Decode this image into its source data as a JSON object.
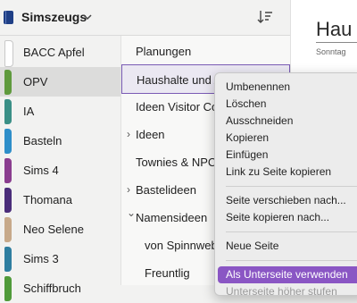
{
  "notebook": {
    "title": "Simszeugs"
  },
  "sections": [
    {
      "label": "BACC Apfel",
      "color": "#ffffff",
      "selected": false
    },
    {
      "label": "OPV",
      "color": "#5f9a3d",
      "selected": true
    },
    {
      "label": "IA",
      "color": "#3a8f86",
      "selected": false
    },
    {
      "label": "Basteln",
      "color": "#2e8ec9",
      "selected": false
    },
    {
      "label": "Sims 4",
      "color": "#8a3d8f",
      "selected": false
    },
    {
      "label": "Thomana",
      "color": "#4a2d7a",
      "selected": false
    },
    {
      "label": "Neo Selene",
      "color": "#c7a98a",
      "selected": false
    },
    {
      "label": "Sims 3",
      "color": "#2f7ea0",
      "selected": false
    },
    {
      "label": "Schiffbruch",
      "color": "#4f9a3a",
      "selected": false
    }
  ],
  "pages": [
    {
      "label": "Planungen",
      "level": 0,
      "expandable": false,
      "selected": false
    },
    {
      "label": "Haushalte und A",
      "level": 0,
      "expandable": false,
      "selected": true
    },
    {
      "label": "Ideen Visitor Co",
      "level": 0,
      "expandable": false,
      "selected": false
    },
    {
      "label": "Ideen",
      "level": 0,
      "expandable": true,
      "selected": false
    },
    {
      "label": "Townies & NPCs",
      "level": 0,
      "expandable": false,
      "selected": false
    },
    {
      "label": "Bastelideen",
      "level": 0,
      "expandable": true,
      "selected": false
    },
    {
      "label": "Namensideen",
      "level": 0,
      "expandable": true,
      "expanded": true,
      "selected": false
    },
    {
      "label": "von Spinnweb",
      "level": 1,
      "expandable": false,
      "selected": false
    },
    {
      "label": "Freuntlig",
      "level": 1,
      "expandable": false,
      "selected": false
    }
  ],
  "content": {
    "title": "Hau",
    "date": "Sonntag"
  },
  "context_menu": {
    "items": [
      {
        "label": "Umbenennen"
      },
      {
        "label": "Löschen"
      },
      {
        "label": "Ausschneiden"
      },
      {
        "label": "Kopieren"
      },
      {
        "label": "Einfügen"
      },
      {
        "label": "Link zu Seite kopieren"
      },
      {
        "separator": true
      },
      {
        "label": "Seite verschieben nach..."
      },
      {
        "label": "Seite kopieren nach..."
      },
      {
        "separator": true
      },
      {
        "label": "Neue Seite"
      },
      {
        "separator": true
      },
      {
        "label": "Als Unterseite verwenden",
        "highlighted": true
      },
      {
        "label": "Unterseite höher stufen",
        "disabled": true
      }
    ]
  },
  "colors": {
    "accent": "#8a56c4",
    "notebook_icon": "#1f3f86"
  },
  "icons": {
    "notebook": "notebook-icon",
    "chevron": "chevron-down-icon",
    "sort": "sort-icon",
    "expand": "chevron-right-icon"
  }
}
